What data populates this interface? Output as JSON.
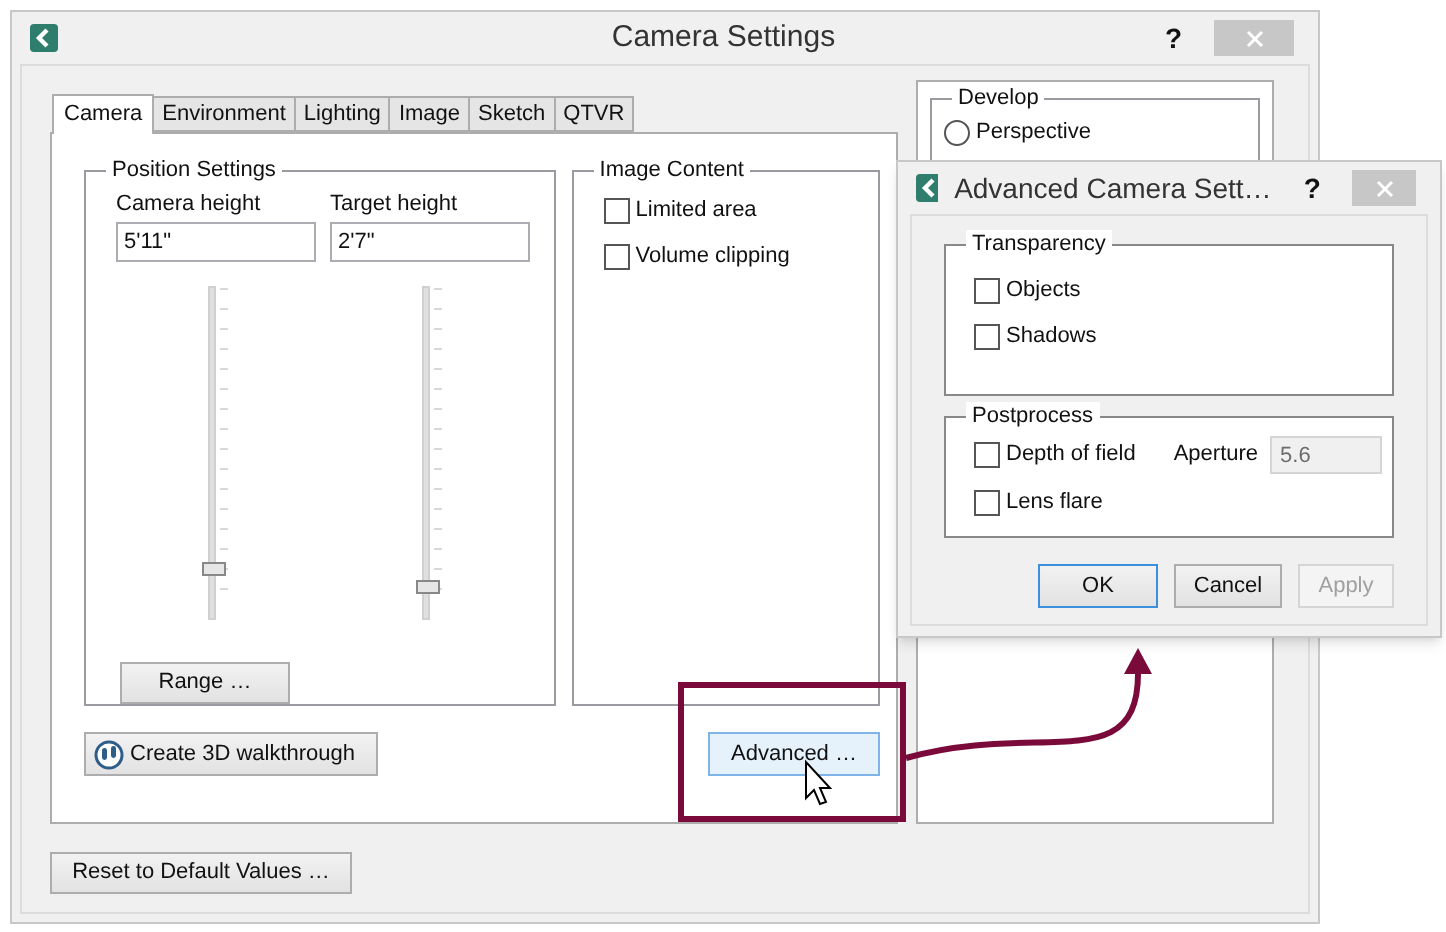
{
  "main_window": {
    "title": "Camera Settings",
    "help": "?",
    "tabs": [
      {
        "label": "Camera",
        "selected": true
      },
      {
        "label": "Environment",
        "selected": false
      },
      {
        "label": "Lighting",
        "selected": false
      },
      {
        "label": "Image",
        "selected": false
      },
      {
        "label": "Sketch",
        "selected": false
      },
      {
        "label": "QTVR",
        "selected": false
      }
    ],
    "position_settings": {
      "title": "Position Settings",
      "fields": [
        {
          "label": "Camera height",
          "value": "5'11\"",
          "level": 0.13
        },
        {
          "label": "Target height",
          "value": "2'7\"",
          "level": 0.08
        }
      ],
      "range_button": "Range …"
    },
    "image_content": {
      "title": "Image Content",
      "checkboxes": [
        {
          "label": "Limited area",
          "checked": false
        },
        {
          "label": "Volume clipping",
          "checked": false
        }
      ]
    },
    "walkthrough_button": "Create 3D walkthrough",
    "advanced_button": "Advanced …",
    "reset_button": "Reset to Default Values …",
    "develop": {
      "title": "Develop",
      "options": [
        {
          "label": "Perspective",
          "selected": false
        }
      ]
    }
  },
  "advanced_dialog": {
    "title": "Advanced Camera Sett…",
    "help": "?",
    "transparency": {
      "title": "Transparency",
      "checkboxes": [
        {
          "label": "Objects",
          "checked": false
        },
        {
          "label": "Shadows",
          "checked": false
        }
      ]
    },
    "postprocess": {
      "title": "Postprocess",
      "checkboxes": [
        {
          "label": "Depth of field",
          "checked": false
        },
        {
          "label": "Lens flare",
          "checked": false
        }
      ],
      "aperture": {
        "label": "Aperture",
        "value": "5.6",
        "disabled": true
      }
    },
    "buttons": [
      {
        "label": "OK",
        "kind": "default",
        "disabled": false
      },
      {
        "label": "Cancel",
        "kind": "normal",
        "disabled": false
      },
      {
        "label": "Apply",
        "kind": "normal",
        "disabled": true
      }
    ]
  }
}
